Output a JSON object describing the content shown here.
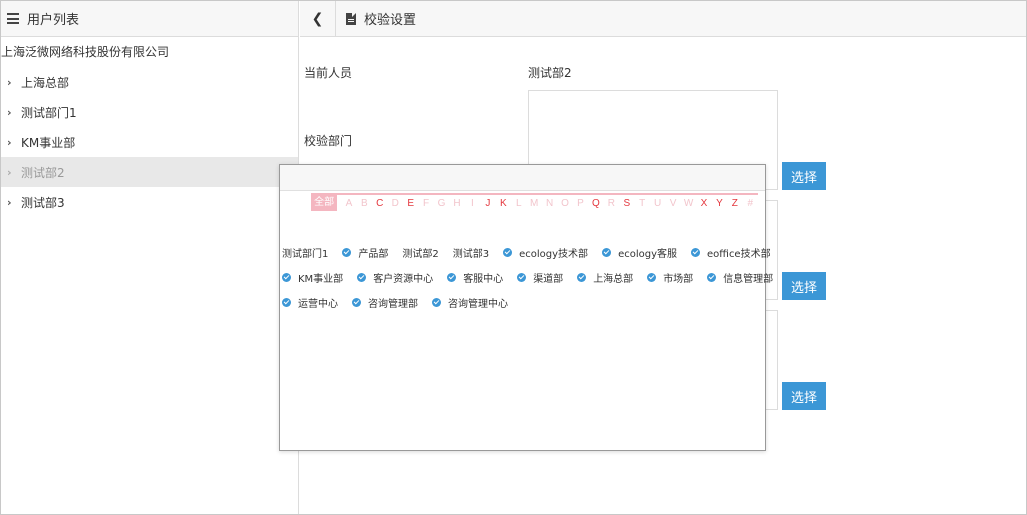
{
  "left_panel": {
    "title": "用户列表",
    "company": "上海泛微网络科技股份有限公司",
    "tree": [
      {
        "label": "上海总部",
        "active": false
      },
      {
        "label": "测试部门1",
        "active": false
      },
      {
        "label": "KM事业部",
        "active": false
      },
      {
        "label": "测试部2",
        "active": true
      },
      {
        "label": "测试部3",
        "active": false
      }
    ]
  },
  "right_panel": {
    "back_icon": "chevron-left-icon",
    "title_icon": "document-icon",
    "title": "校验设置",
    "current_person_label": "当前人员",
    "current_person_value": "测试部2",
    "check_dept_label": "校验部门",
    "select_labels": [
      "选择",
      "选择",
      "选择"
    ]
  },
  "popup": {
    "all_label": "全部",
    "letters": [
      {
        "l": "A",
        "has": false
      },
      {
        "l": "B",
        "has": false
      },
      {
        "l": "C",
        "has": true
      },
      {
        "l": "D",
        "has": false
      },
      {
        "l": "E",
        "has": true
      },
      {
        "l": "F",
        "has": false
      },
      {
        "l": "G",
        "has": false
      },
      {
        "l": "H",
        "has": false
      },
      {
        "l": "I",
        "has": false
      },
      {
        "l": "J",
        "has": true
      },
      {
        "l": "K",
        "has": true
      },
      {
        "l": "L",
        "has": false
      },
      {
        "l": "M",
        "has": false
      },
      {
        "l": "N",
        "has": false
      },
      {
        "l": "O",
        "has": false
      },
      {
        "l": "P",
        "has": false
      },
      {
        "l": "Q",
        "has": true
      },
      {
        "l": "R",
        "has": false
      },
      {
        "l": "S",
        "has": true
      },
      {
        "l": "T",
        "has": false
      },
      {
        "l": "U",
        "has": false
      },
      {
        "l": "V",
        "has": false
      },
      {
        "l": "W",
        "has": false
      },
      {
        "l": "X",
        "has": true
      },
      {
        "l": "Y",
        "has": true
      },
      {
        "l": "Z",
        "has": true
      },
      {
        "l": "#",
        "has": false
      }
    ],
    "departments": [
      [
        {
          "name": "测试部门1",
          "checked": false
        },
        {
          "name": "产品部",
          "checked": true
        },
        {
          "name": "测试部2",
          "checked": false
        },
        {
          "name": "测试部3",
          "checked": false
        },
        {
          "name": "ecology技术部",
          "checked": true
        },
        {
          "name": "ecology客服",
          "checked": true
        },
        {
          "name": "eoffice技术部",
          "checked": true
        }
      ],
      [
        {
          "name": "KM事业部",
          "checked": true
        },
        {
          "name": "客户资源中心",
          "checked": true
        },
        {
          "name": "客服中心",
          "checked": true
        },
        {
          "name": "渠道部",
          "checked": true
        },
        {
          "name": "上海总部",
          "checked": true
        },
        {
          "name": "市场部",
          "checked": true
        },
        {
          "name": "信息管理部",
          "checked": true
        }
      ],
      [
        {
          "name": "运营中心",
          "checked": true
        },
        {
          "name": "咨询管理部",
          "checked": true
        },
        {
          "name": "咨询管理中心",
          "checked": true
        }
      ]
    ]
  },
  "colors": {
    "accent": "#3c97d6",
    "letter_active": "#e4373e",
    "letter_inactive": "#f2c5cc",
    "letter_bar": "#f4b6c0"
  }
}
